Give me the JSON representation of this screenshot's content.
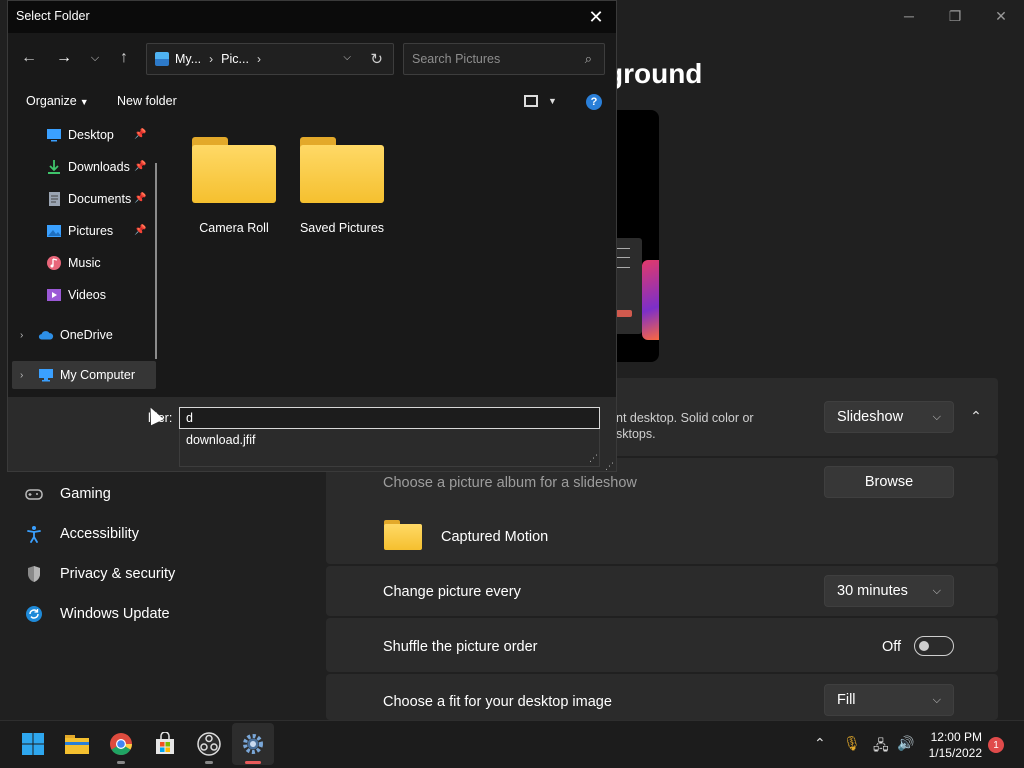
{
  "settings": {
    "heading": "ground",
    "sidebar": [
      {
        "label": "Gaming",
        "icon": "gamepad-icon"
      },
      {
        "label": "Accessibility",
        "icon": "accessibility-icon"
      },
      {
        "label": "Privacy & security",
        "icon": "shield-icon"
      },
      {
        "label": "Windows Update",
        "icon": "update-icon"
      }
    ],
    "background_desc_line1": "nt desktop. Solid color or",
    "background_desc_line2": "sktops.",
    "background_type": "Slideshow",
    "album_label": "Choose a picture album for a slideshow",
    "browse_label": "Browse",
    "album_name": "Captured Motion",
    "change_every_label": "Change picture every",
    "change_every_value": "30 minutes",
    "shuffle_label": "Shuffle the picture order",
    "shuffle_state": "Off",
    "fit_label": "Choose a fit for your desktop image",
    "fit_value": "Fill"
  },
  "dialog": {
    "title": "Select Folder",
    "address": {
      "seg1": "My...",
      "seg2": "Pic..."
    },
    "search_placeholder": "Search Pictures",
    "organize_label": "Organize",
    "new_folder_label": "New folder",
    "help_glyph": "?",
    "nav": [
      {
        "label": "Desktop",
        "pinned": true
      },
      {
        "label": "Downloads",
        "pinned": true
      },
      {
        "label": "Documents",
        "pinned": true
      },
      {
        "label": "Pictures",
        "pinned": true
      },
      {
        "label": "Music",
        "pinned": false
      },
      {
        "label": "Videos",
        "pinned": false
      },
      {
        "label": "OneDrive",
        "pinned": false
      },
      {
        "label": "My Computer",
        "pinned": false
      }
    ],
    "folders": [
      {
        "label": "Camera Roll"
      },
      {
        "label": "Saved Pictures"
      }
    ],
    "folder_field_label": "lder:",
    "folder_field_value": "d",
    "autocomplete": [
      "download.jfif"
    ]
  },
  "taskbar": {
    "time": "12:00 PM",
    "date": "1/15/2022",
    "notification_count": "1"
  },
  "colors": {
    "accent": "#2a7fd8",
    "folder": "#f5c02f",
    "notification": "#e04b4b"
  }
}
